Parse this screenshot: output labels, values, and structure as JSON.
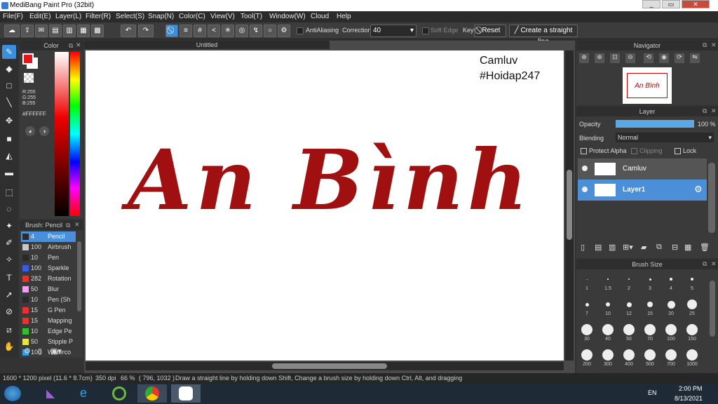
{
  "window": {
    "title": "MediBang Paint Pro (32bit)",
    "min": "_",
    "max": "▭",
    "close": "✕"
  },
  "menu": [
    "File(F)",
    "Edit(E)",
    "Layer(L)",
    "Filter(R)",
    "Select(S)",
    "Snap(N)",
    "Color(C)",
    "View(V)",
    "Tool(T)",
    "Window(W)",
    "Cloud",
    "Help"
  ],
  "toolbar": {
    "antialiasing": "AntiAliasing",
    "correction_label": "Correction",
    "correction_value": "40",
    "soft_edge": "Soft Edge",
    "key": "Key",
    "reset": "Reset",
    "straight_line": "Create a straight line"
  },
  "color": {
    "title": "Color",
    "r": "R:255",
    "g": "G:255",
    "b": "B:255",
    "hex": "#FFFFFF",
    "primary": "#e8161a",
    "secondary": "#ffffff"
  },
  "brush": {
    "title": "Brush: Pencil",
    "items": [
      {
        "size": "4",
        "name": "Pencil",
        "color": "#2a2a2a"
      },
      {
        "size": "100",
        "name": "Airbrush",
        "color": "#c8c8c8"
      },
      {
        "size": "10",
        "name": "Pen",
        "color": "#2a2a2a"
      },
      {
        "size": "100",
        "name": "Sparkle",
        "color": "#3a5de0"
      },
      {
        "size": "282",
        "name": "Rotation",
        "color": "#e83030"
      },
      {
        "size": "50",
        "name": "Blur",
        "color": "#f0a0f0"
      },
      {
        "size": "10",
        "name": "Pen (Sh",
        "color": "#2a2a2a"
      },
      {
        "size": "15",
        "name": "G Pen",
        "color": "#e83030"
      },
      {
        "size": "15",
        "name": "Mapping",
        "color": "#e83030"
      },
      {
        "size": "10",
        "name": "Edge Pe",
        "color": "#30c030"
      },
      {
        "size": "50",
        "name": "Stipple P",
        "color": "#e8e830"
      },
      {
        "size": "100",
        "name": "Waterco",
        "color": "#30a0e8"
      }
    ]
  },
  "canvas": {
    "tab": "Untitled",
    "overlay1": "Camluv",
    "overlay2": "#Hoidap247",
    "art_text": "An Bình",
    "art_color": "#a01010"
  },
  "navigator": {
    "title": "Navigator",
    "thumb_text": "An Bình"
  },
  "layer": {
    "title": "Layer",
    "opacity_label": "Opacity",
    "opacity_value": "100 %",
    "opacity_fraction": 1.0,
    "blending_label": "Blending",
    "blending_value": "Normal",
    "protect_alpha": "Protect Alpha",
    "clipping": "Clipping",
    "lock": "Lock",
    "layers": [
      {
        "name": "Camluv",
        "selected": false
      },
      {
        "name": "Layer1",
        "selected": true
      }
    ]
  },
  "brush_size": {
    "title": "Brush Size",
    "sizes": [
      "1",
      "1.5",
      "2",
      "3",
      "4",
      "5",
      "7",
      "10",
      "12",
      "15",
      "20",
      "25",
      "30",
      "40",
      "50",
      "70",
      "100",
      "150",
      "200",
      "300",
      "400",
      "500",
      "700",
      "1000"
    ]
  },
  "status": {
    "pixel": "1600 * 1200 pixel",
    "cm": "(11.6 * 8.7cm)",
    "dpi": "350 dpi",
    "zoom": "66 %",
    "coords": "( 796, 1032 )",
    "hint": "Draw a straight line by holding down Shift, Change a brush size by holding down Ctrl, Alt, and dragging"
  },
  "taskbar": {
    "lang": "EN",
    "time": "2:00 PM",
    "date": "8/13/2021"
  }
}
